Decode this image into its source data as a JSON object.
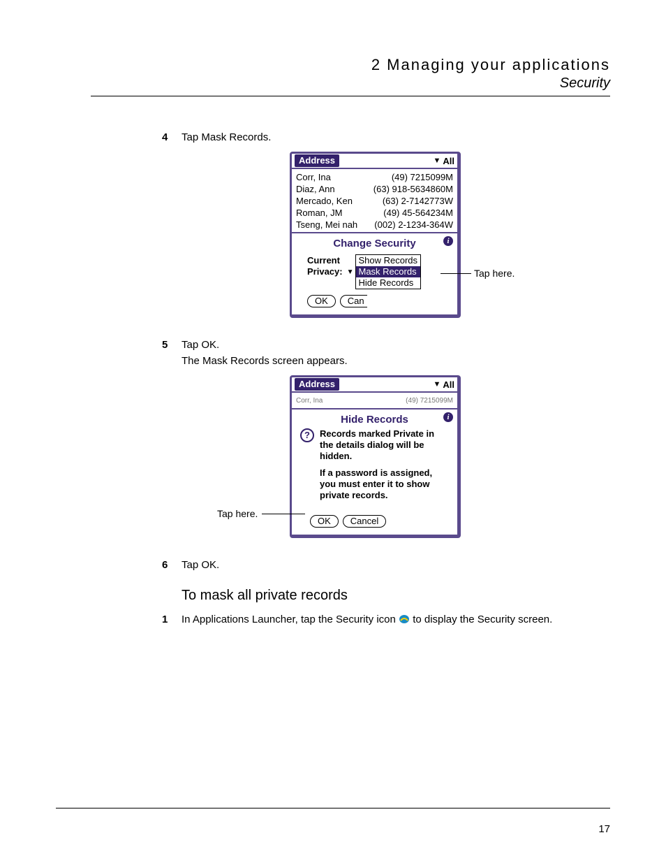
{
  "header": {
    "chapter": "2 Managing your applications",
    "section": "Security"
  },
  "page_number": "17",
  "steps": {
    "s4": {
      "num": "4",
      "text": "Tap Mask Records."
    },
    "s5": {
      "num": "5",
      "text": "Tap OK.",
      "sub": "The Mask Records screen appears."
    },
    "s6": {
      "num": "6",
      "text": "Tap OK."
    }
  },
  "subhead": "To mask all private records",
  "sub_step1": {
    "num": "1",
    "before": "In Applications Launcher, tap the Security icon ",
    "after": " to display the Security screen."
  },
  "callouts": {
    "fig1": "Tap here.",
    "fig2": "Tap here."
  },
  "fig1": {
    "title": "Address",
    "category": "All",
    "records": [
      {
        "name": "Corr, Ina",
        "phone": "(49) 7215099M"
      },
      {
        "name": "Diaz, Ann",
        "phone": "(63) 918-5634860M"
      },
      {
        "name": "Mercado, Ken",
        "phone": "(63) 2-7142773W"
      },
      {
        "name": "Roman, JM",
        "phone": "(49) 45-564234M"
      },
      {
        "name": "Tseng, Mei nah",
        "phone": "(002) 2-1234-364W"
      }
    ],
    "dialog_title": "Change Security",
    "current_label_line1": "Current",
    "current_label_line2": "Privacy:",
    "options": [
      "Show Records",
      "Mask Records",
      "Hide Records"
    ],
    "selected_index": 1,
    "btn_ok": "OK",
    "btn_cancel_partial": "Can"
  },
  "fig2": {
    "title": "Address",
    "category": "All",
    "partial_record": {
      "name": "Corr, Ina",
      "phone": "(49) 7215099M"
    },
    "dialog_title": "Hide Records",
    "msg_p1": "Records marked Private in the details dialog will be hidden.",
    "msg_p2": "If a password is assigned, you must enter it to show private records.",
    "btn_ok": "OK",
    "btn_cancel": "Cancel"
  }
}
